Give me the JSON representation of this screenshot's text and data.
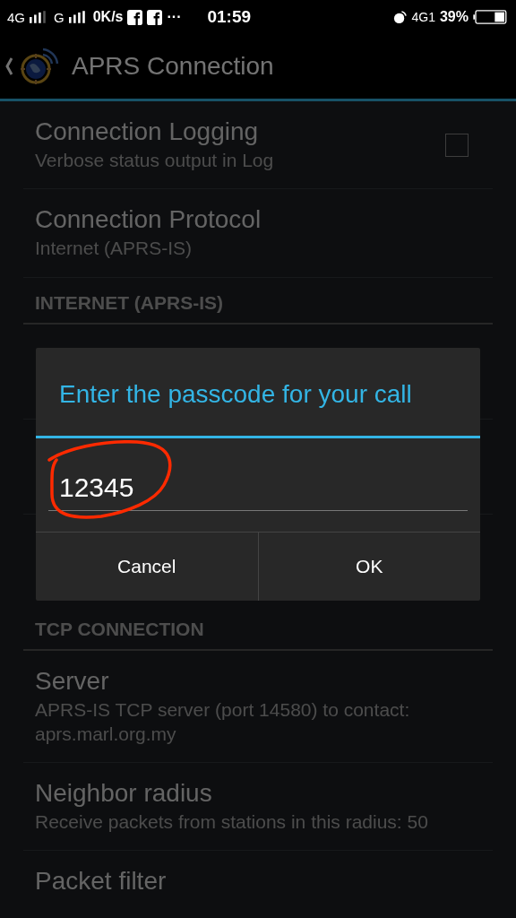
{
  "status_bar": {
    "network_1": "4G",
    "network_2": "G",
    "speed": "0K/s",
    "more": "···",
    "time": "01:59",
    "network_3": "4G1",
    "battery": "39%"
  },
  "action_bar": {
    "title": "APRS Connection"
  },
  "top_preferences": [
    {
      "kind": "checkbox",
      "title": "Connection Logging",
      "summary": "Verbose status output in Log",
      "checked": false
    },
    {
      "kind": "plain",
      "title": "Connection Protocol",
      "summary": "Internet (APRS-IS)"
    }
  ],
  "section_1": {
    "header": "INTERNET (APRS-IS)"
  },
  "section_2": {
    "header": "TCP CONNECTION",
    "preferences": [
      {
        "title": "Server",
        "summary": "APRS-IS TCP server (port 14580) to contact: aprs.marl.org.my"
      },
      {
        "title": "Neighbor radius",
        "summary": "Receive packets from stations in this radius: 50"
      },
      {
        "title": "Packet filter"
      }
    ]
  },
  "dialog": {
    "title": "Enter the passcode for your call",
    "value": "12345",
    "buttons": [
      "Cancel",
      "OK"
    ]
  }
}
